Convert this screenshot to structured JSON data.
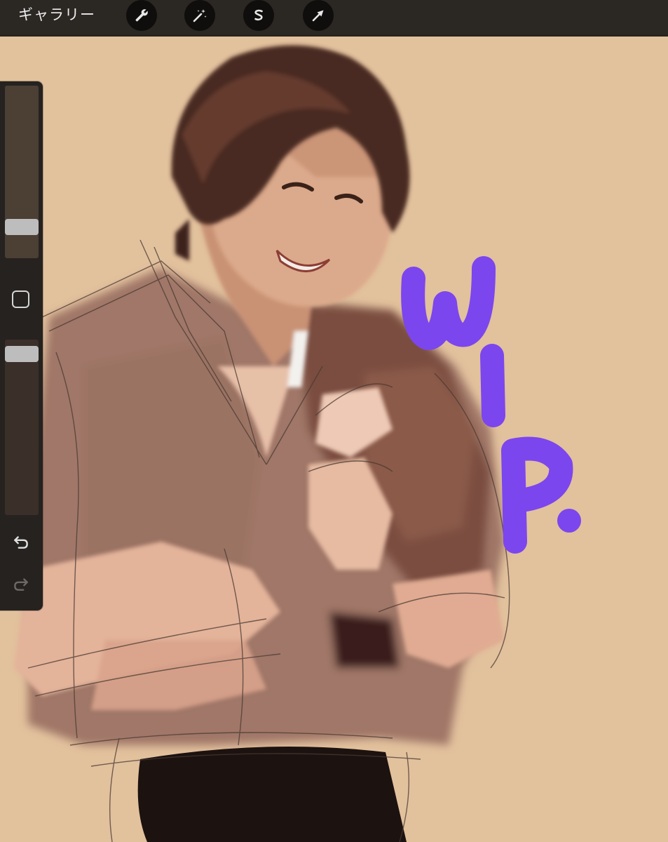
{
  "topbar": {
    "gallery_label": "ギャラリー",
    "tools": [
      {
        "name": "actions",
        "icon": "wrench-icon"
      },
      {
        "name": "adjustments",
        "icon": "magic-wand-icon"
      },
      {
        "name": "selection",
        "icon": "selection-s-icon"
      },
      {
        "name": "transform",
        "icon": "arrow-cursor-icon"
      }
    ]
  },
  "sidebar": {
    "brush_size": 0.15,
    "brush_opacity": 0.96,
    "modifier_icon": "square-icon",
    "undo_icon": "undo-icon",
    "redo_icon": "redo-icon"
  },
  "canvas": {
    "annotation_text": "WIP.",
    "annotation_color": "#7b46ee",
    "background_color": "#e2c19d"
  }
}
